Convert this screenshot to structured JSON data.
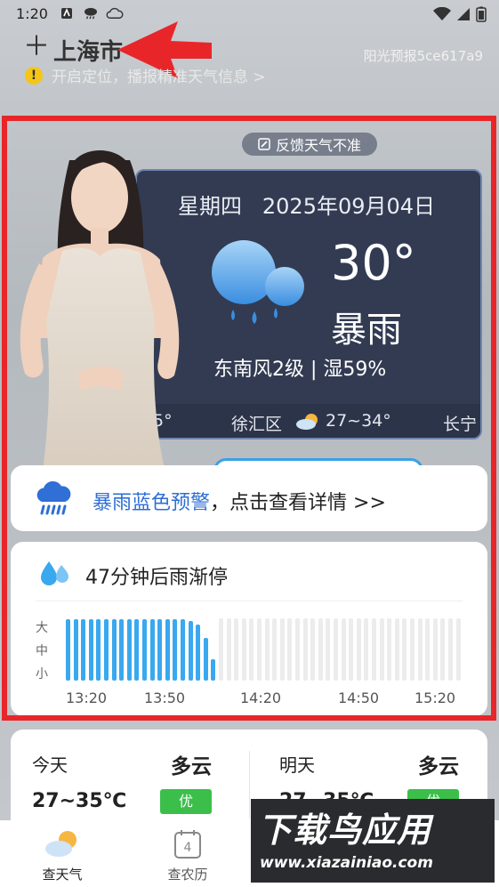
{
  "status_bar": {
    "time": "1:20"
  },
  "header": {
    "add_icon": "plus-icon",
    "city": "上海市",
    "brand": "阳光预报5ce617a9",
    "location_prompt": "开启定位，播报精准天气信息 >"
  },
  "feedback": {
    "label": "反馈天气不准"
  },
  "today": {
    "weekday": "星期四",
    "date": "2025年09月04日",
    "temperature": "30°",
    "condition": "暴雨",
    "wind_humidity": "东南风2级 | 湿59%"
  },
  "district_strip": {
    "partial_left": "5°",
    "district": "徐汇区",
    "range": "27~34°",
    "partial_right": "长宁"
  },
  "alert": {
    "highlight": "暴雨蓝色预警",
    "rest": "，点击查看详情 >>"
  },
  "rain": {
    "title": "47分钟后雨渐停",
    "y_levels": [
      "大",
      "中",
      "小"
    ],
    "x_labels": [
      "13:20",
      "13:50",
      "14:20",
      "14:50",
      "15:20"
    ],
    "intensity": [
      0.98,
      0.98,
      0.98,
      0.98,
      0.98,
      0.98,
      0.98,
      0.98,
      0.98,
      0.98,
      0.98,
      0.98,
      0.98,
      0.98,
      0.98,
      0.98,
      0.96,
      0.9,
      0.68,
      0.35,
      0,
      0,
      0,
      0,
      0,
      0,
      0,
      0,
      0,
      0,
      0,
      0,
      0,
      0,
      0,
      0,
      0,
      0,
      0,
      0,
      0,
      0,
      0,
      0,
      0,
      0,
      0,
      0,
      0,
      0,
      0,
      0
    ],
    "rain_color": "#3aa8ef",
    "empty_color": "#ececec"
  },
  "forecast": [
    {
      "day": "今天",
      "condition": "多云",
      "temp": "27~35℃",
      "aqi": "优"
    },
    {
      "day": "明天",
      "condition": "多云",
      "temp": "27~35℃",
      "aqi": "优"
    }
  ],
  "nav": [
    {
      "label": "查天气",
      "icon": "weather-icon"
    },
    {
      "label": "查农历",
      "icon": "calendar-icon",
      "badge": "4"
    }
  ],
  "watermark": {
    "big": "下载鸟应用",
    "small": "www.xiazainiao.com"
  }
}
